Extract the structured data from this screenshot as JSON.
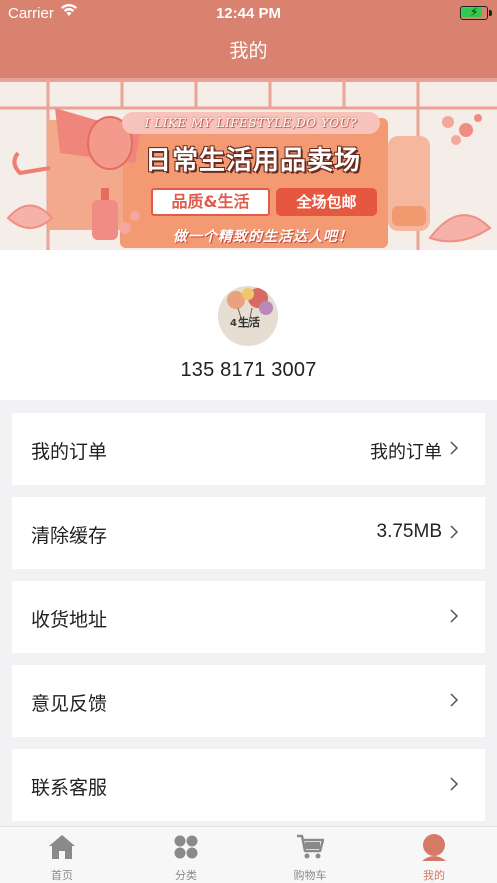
{
  "status_bar": {
    "carrier": "Carrier",
    "time": "12:44 PM"
  },
  "nav": {
    "title": "我的"
  },
  "banner": {
    "tagline": "I LIKE MY LIFESTYLE,DO YOU?",
    "headline": "日常生活用品卖场",
    "badge_quality": "品质&生活",
    "badge_shipping": "全场包邮",
    "slogan": "做一个精致的生活达人吧！"
  },
  "profile": {
    "avatar_text": "生活",
    "phone": "135 8171 3007"
  },
  "menu": [
    {
      "label": "我的订单",
      "value": "我的订单"
    },
    {
      "label": "清除缓存",
      "value": "3.75MB"
    },
    {
      "label": "收货地址",
      "value": ""
    },
    {
      "label": "意见反馈",
      "value": ""
    },
    {
      "label": "联系客服",
      "value": ""
    }
  ],
  "tabs": [
    {
      "label": "首页",
      "icon": "home-icon",
      "active": false
    },
    {
      "label": "分类",
      "icon": "grid-icon",
      "active": false
    },
    {
      "label": "购物车",
      "icon": "cart-icon",
      "active": false
    },
    {
      "label": "我的",
      "icon": "user-icon",
      "active": true
    }
  ],
  "colors": {
    "accent": "#d98270",
    "tab_active": "#d47a66",
    "tab_inactive": "#8a8a8a"
  }
}
